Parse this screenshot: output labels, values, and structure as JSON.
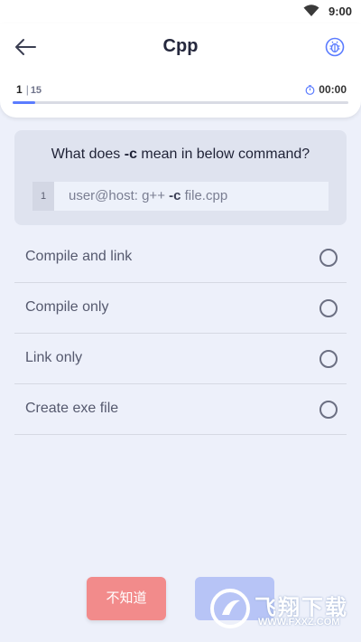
{
  "status_bar": {
    "time": "9:00",
    "wifi_icon": "wifi-icon"
  },
  "header": {
    "title": "Cpp",
    "back_icon": "back-arrow-icon",
    "bug_icon": "bug-report-icon",
    "progress": {
      "current": "1",
      "separator": "|",
      "total": "15",
      "fraction": 0.0667
    },
    "timer": {
      "icon": "stopwatch-icon",
      "value": "00:00"
    }
  },
  "question": {
    "prefix": "What does ",
    "highlight": "-c",
    "suffix": " mean in below command?",
    "code": {
      "line_number": "1",
      "command_prefix": "user@host: g++ ",
      "command_flag": "-c",
      "command_suffix": " file.cpp"
    }
  },
  "options": [
    {
      "label": "Compile and link"
    },
    {
      "label": "Compile only"
    },
    {
      "label": "Link only"
    },
    {
      "label": "Create exe file"
    }
  ],
  "buttons": {
    "dont_know": "不知道",
    "next": ""
  },
  "watermark": {
    "title": "飞翔下载",
    "site": "WWW.FXXZ.COM"
  },
  "colors": {
    "background": "#edf0fa",
    "accent": "#5b7cff",
    "dont_know_button": "#f28b8b",
    "next_button": "#b7c4f6",
    "question_card": "#dfe3ef"
  }
}
